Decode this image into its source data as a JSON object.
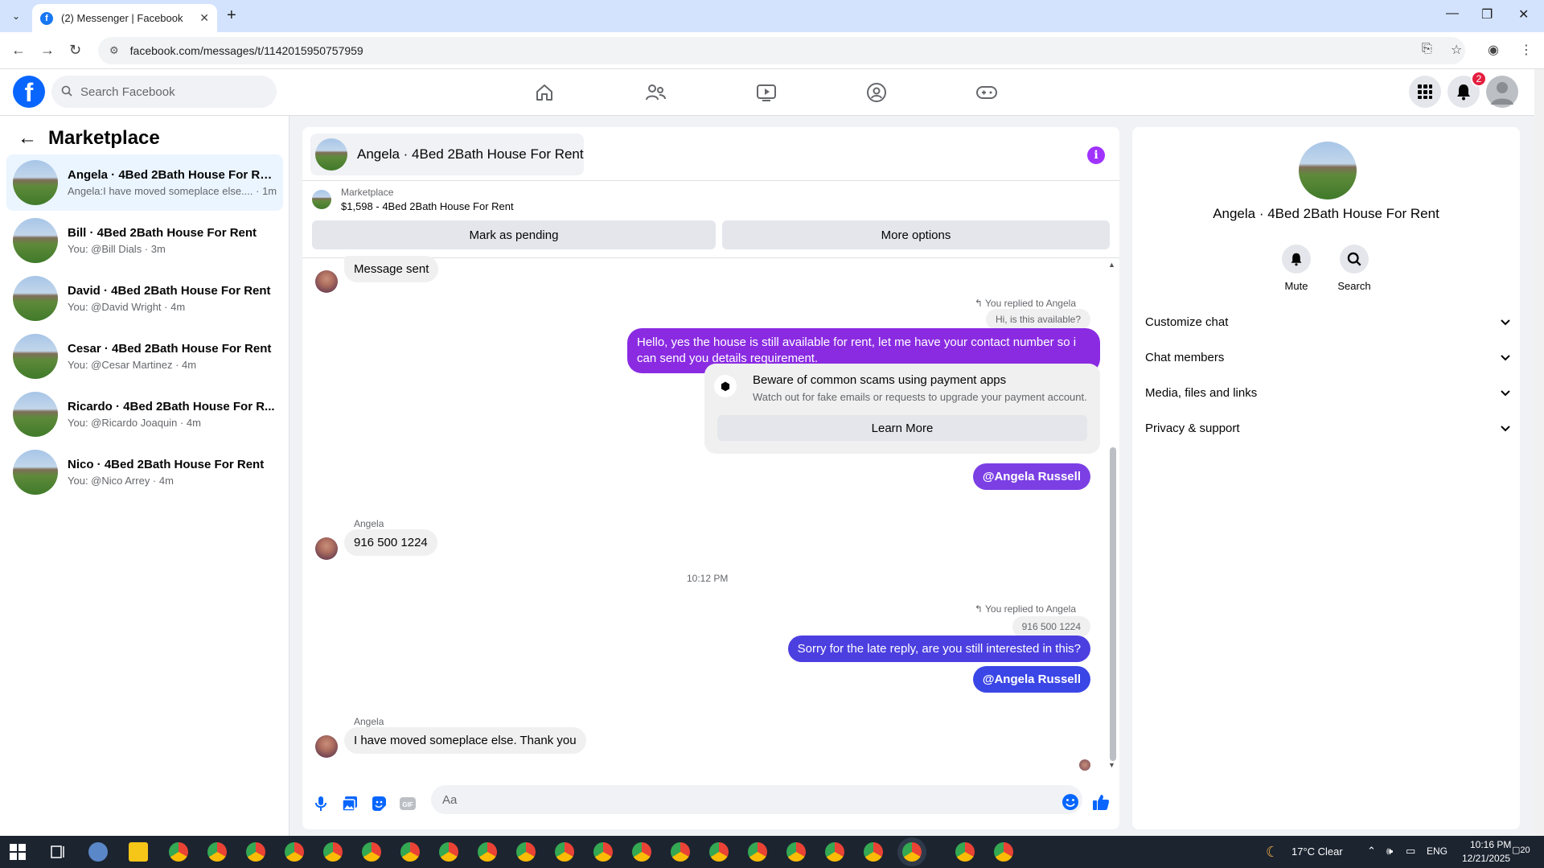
{
  "browser": {
    "tab_title": "(2) Messenger | Facebook",
    "tab_favicon": "f",
    "url": "facebook.com/messages/t/1142015950757959"
  },
  "header": {
    "logo": "f",
    "search_placeholder": "Search Facebook",
    "notification_count": "2"
  },
  "sidebar": {
    "title": "Marketplace",
    "conversations": [
      {
        "name": "Angela · 4Bed 2Bath House For Rent",
        "snippet": "Angela:I have moved someplace else.... · 1m"
      },
      {
        "name": "Bill · 4Bed 2Bath House For Rent",
        "snippet": "You: @Bill Dials · 3m"
      },
      {
        "name": "David · 4Bed 2Bath House For Rent",
        "snippet": "You: @David Wright · 4m"
      },
      {
        "name": "Cesar · 4Bed 2Bath House For Rent",
        "snippet": "You: @Cesar Martinez · 4m"
      },
      {
        "name": "Ricardo · 4Bed 2Bath House For R...",
        "snippet": "You: @Ricardo Joaquin · 4m"
      },
      {
        "name": "Nico · 4Bed 2Bath House For Rent",
        "snippet": "You: @Nico Arrey · 4m"
      }
    ]
  },
  "chat": {
    "title": "Angela · 4Bed 2Bath House For Rent",
    "info_icon": "i",
    "marketplace_label": "Marketplace",
    "listing": "$1,598 - 4Bed 2Bath House For Rent",
    "mark_pending": "Mark as pending",
    "more_options": "More options",
    "messages": {
      "message_sent": "Message sent",
      "reply_note_1": "You replied to Angela",
      "quote_1": "Hi, is this available?",
      "out_1": "Hello, yes the house is still available for rent, let me have your contact number so i can send you details requirement.",
      "scam_title": "Beware of common scams using payment apps",
      "scam_sub": "Watch out for fake emails or requests to upgrade your payment account.",
      "learn_more": "Learn More",
      "mention_1": "@Angela Russell",
      "sender_1": "Angela",
      "in_1": "916 500 1224",
      "time": "10:12 PM",
      "reply_note_2": "You replied to Angela",
      "quote_2": "916 500 1224",
      "out_2": "Sorry for the late reply, are you still interested in this?",
      "mention_2": "@Angela Russell",
      "sender_2": "Angela",
      "in_2": "I have moved someplace else.  Thank you"
    },
    "composer_placeholder": "Aa"
  },
  "details": {
    "name": "Angela · 4Bed 2Bath House For Rent",
    "mute": "Mute",
    "search": "Search",
    "sections": [
      "Customize chat",
      "Chat members",
      "Media, files and links",
      "Privacy & support"
    ]
  },
  "taskbar": {
    "weather": "17°C  Clear",
    "lang": "ENG",
    "time": "10:16 PM",
    "date": "12/21/2025",
    "notif": "20"
  },
  "colors": {
    "fb_blue": "#0866ff",
    "bubble_purple": "#8a2be2",
    "bubble_indigo": "#4f46e5",
    "badge_red": "#e41e3f"
  }
}
